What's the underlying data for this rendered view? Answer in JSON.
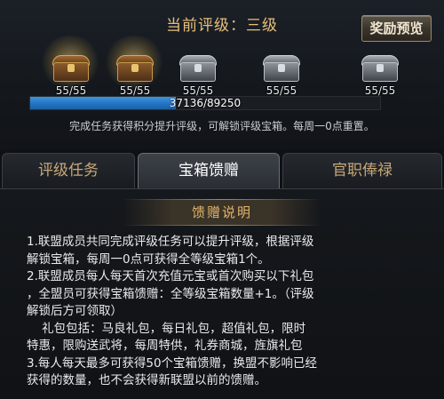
{
  "header": {
    "rank_title": "当前评级：三级",
    "reward_preview_label": "奖励预览"
  },
  "chests": [
    {
      "icon": "gold-chest-icon",
      "count": "55/55",
      "glow": true
    },
    {
      "icon": "gold-chest-icon",
      "count": "55/55",
      "glow": true
    },
    {
      "icon": "silver-chest-icon",
      "count": "55/55",
      "glow": false
    },
    {
      "icon": "silver-chest-icon",
      "count": "55/55",
      "glow": false
    },
    {
      "icon": "silver-chest-icon",
      "count": "55/55",
      "glow": false
    }
  ],
  "progress": {
    "text": "37136/89250",
    "current": 37136,
    "max": 89250
  },
  "hint": "完成任务获得积分提升评级，可解锁评级宝箱。每周一0点重置。",
  "tabs": [
    {
      "label": "评级任务",
      "active": false
    },
    {
      "label": "宝箱馈赠",
      "active": true
    },
    {
      "label": "官职俸禄",
      "active": false
    }
  ],
  "section": {
    "title": "馈赠说明",
    "lines": [
      "1.联盟成员共同完成评级任务可以提升评级，根据评级",
      "解锁宝箱，每周一0点可获得全等级宝箱1个。",
      "2.联盟成员每人每天首次充值元宝或首次购买以下礼包",
      "，全盟员可获得宝箱馈赠：全等级宝箱数量+1。（评级",
      "解锁后方可领取）",
      "    礼包包括：马良礼包，每日礼包，超值礼包，限时",
      "特惠，限购送武将，每周特供，礼券商城，旌旗礼包",
      "3.每人每天最多可获得50个宝箱馈赠，换盟不影响已经",
      "获得的数量，也不会获得新联盟以前的馈赠。"
    ]
  },
  "colors": {
    "accent_gold": "#e3b56a",
    "progress_blue": "#2374c4"
  }
}
